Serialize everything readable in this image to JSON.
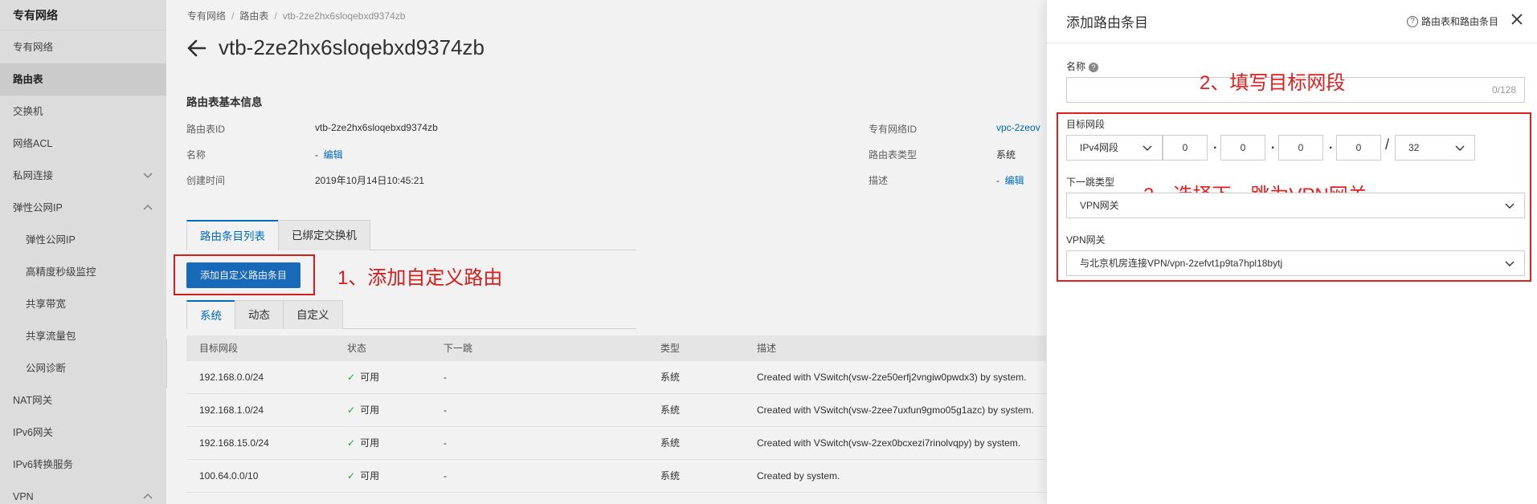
{
  "sidebar": {
    "title": "专有网络",
    "items": [
      {
        "label": "专有网络"
      },
      {
        "label": "路由表"
      },
      {
        "label": "交换机"
      },
      {
        "label": "网络ACL"
      },
      {
        "label": "私网连接"
      },
      {
        "label": "弹性公网IP"
      },
      {
        "label": "弹性公网IP"
      },
      {
        "label": "高精度秒级监控"
      },
      {
        "label": "共享带宽"
      },
      {
        "label": "共享流量包"
      },
      {
        "label": "公网诊断"
      },
      {
        "label": "NAT网关"
      },
      {
        "label": "IPv6网关"
      },
      {
        "label": "IPv6转换服务"
      },
      {
        "label": "VPN"
      }
    ]
  },
  "breadcrumb": [
    "专有网络",
    "路由表",
    "vtb-2ze2hx6sloqebxd9374zb"
  ],
  "breadcrumb_sep": "/",
  "page_title": "vtb-2ze2hx6sloqebxd9374zb",
  "basic_info": {
    "title": "路由表基本信息",
    "id_label": "路由表ID",
    "id_value": "vtb-2ze2hx6sloqebxd9374zb",
    "name_label": "名称",
    "name_value": "-",
    "edit": "编辑",
    "created_label": "创建时间",
    "created_value": "2019年10月14日10:45:21",
    "vpc_label": "专有网络ID",
    "vpc_value": "vpc-2zeov",
    "type_label": "路由表类型",
    "type_value": "系统",
    "desc_label": "描述",
    "desc_value": "-"
  },
  "tabs": [
    "路由条目列表",
    "已绑定交换机"
  ],
  "add_button": "添加自定义路由条目",
  "annotations": {
    "a1": "1、添加自定义路由",
    "a2": "2、填写目标网段",
    "a3": "3、选择下一跳为VPN网关"
  },
  "subtabs": [
    "系统",
    "动态",
    "自定义"
  ],
  "table": {
    "headers": [
      "目标网段",
      "状态",
      "下一跳",
      "类型",
      "描述"
    ],
    "rows": [
      {
        "dest": "192.168.0.0/24",
        "status": "可用",
        "next": "-",
        "type": "系统",
        "desc": "Created with VSwitch(vsw-2ze50erfj2vngiw0pwdx3) by system."
      },
      {
        "dest": "192.168.1.0/24",
        "status": "可用",
        "next": "-",
        "type": "系统",
        "desc": "Created with VSwitch(vsw-2zee7uxfun9gmo05g1azc) by system."
      },
      {
        "dest": "192.168.15.0/24",
        "status": "可用",
        "next": "-",
        "type": "系统",
        "desc": "Created with VSwitch(vsw-2zex0bcxezi7rinolvqpy) by system."
      },
      {
        "dest": "100.64.0.0/10",
        "status": "可用",
        "next": "-",
        "type": "系统",
        "desc": "Created by system."
      }
    ]
  },
  "drawer": {
    "title": "添加路由条目",
    "help": "路由表和路由条目",
    "name_label": "名称",
    "name_counter": "0/128",
    "dest_label": "目标网段",
    "ip_type": "IPv4网段",
    "ip": [
      "0",
      "0",
      "0",
      "0"
    ],
    "mask": "32",
    "nexthop_label": "下一跳类型",
    "nexthop_value": "VPN网关",
    "vpn_label": "VPN网关",
    "vpn_value": "与北京机房连接VPN/vpn-2zefvt1p9ta7hpl18bytj"
  },
  "colors": {
    "accent": "#0070cc",
    "button": "#1a6fc1",
    "annotation": "#e02020",
    "success": "#22a745"
  }
}
